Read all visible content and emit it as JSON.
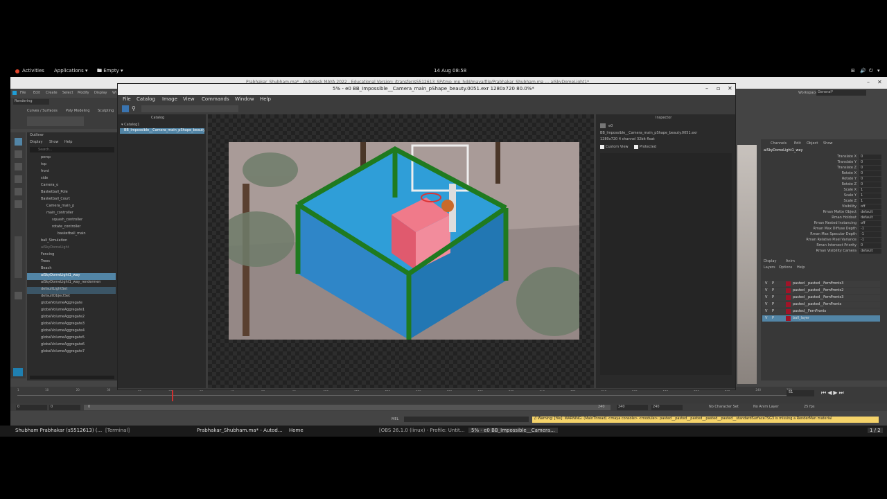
{
  "gnome_bar": {
    "activities": "Activities",
    "applications": "Applications",
    "workspace": "Empty",
    "clock": "14 Aug 08:58"
  },
  "maya": {
    "title": "Prabhakar_Shubham.ma* - Autodesk MAYA 2022 - Educational Version: /transfer/s5512613_SP/tmp_mp_hdd/maya/file/Prabhakar_Shubham.ma --- aiSkyDomeLight1*",
    "menu": [
      "File",
      "Edit",
      "Create",
      "Select",
      "Modify",
      "Display",
      "Wi"
    ],
    "mode": "Rendering",
    "shelf_tabs": [
      "Curves / Surfaces",
      "Poly Modeling",
      "Sculpting"
    ],
    "workspace_label": "Workspace:",
    "workspace_value": "General*",
    "outliner": {
      "title": "Outliner",
      "menu": [
        "Display",
        "Show",
        "Help"
      ],
      "search_placeholder": "Search...",
      "items": [
        "persp",
        "top",
        "front",
        "side",
        "Camera_o",
        "Basketball_Pole",
        "Basketball_Court",
        "Camera_main_p",
        "main_controller",
        "squash_controller",
        "rotate_controller",
        "basketball_main",
        "ball_Simulation",
        "aiSkyDomeLight",
        "Fencing",
        "Trees",
        "Beach",
        "aiSkyDomeLight1_way",
        "aiSkyDomeLight1_way_rendermen",
        "defaultLightSet",
        "defaultObjectSet",
        "globalVolumeAggregate",
        "globalVolumeAggregate1",
        "globalVolumeAggregate2",
        "globalVolumeAggregate3",
        "globalVolumeAggregate4",
        "globalVolumeAggregate5",
        "globalVolumeAggregate6",
        "globalVolumeAggregate7"
      ]
    },
    "channel_box": {
      "menu": [
        "Channels",
        "Edit",
        "Object",
        "Show"
      ],
      "object": "aiSkyDomeLight1_way",
      "attrs": [
        {
          "name": "Translate X",
          "value": "0"
        },
        {
          "name": "Translate Y",
          "value": "0"
        },
        {
          "name": "Translate Z",
          "value": "0"
        },
        {
          "name": "Rotate X",
          "value": "0"
        },
        {
          "name": "Rotate Y",
          "value": "0"
        },
        {
          "name": "Rotate Z",
          "value": "0"
        },
        {
          "name": "Scale X",
          "value": "1"
        },
        {
          "name": "Scale Y",
          "value": "1"
        },
        {
          "name": "Scale Z",
          "value": "1"
        },
        {
          "name": "Visibility",
          "value": "off"
        },
        {
          "name": "Rman Matte Object",
          "value": "default"
        },
        {
          "name": "Rman Holdout",
          "value": "default"
        },
        {
          "name": "Rman Nested Instancing",
          "value": "off"
        },
        {
          "name": "Rman Max Diffuse Depth",
          "value": "-1"
        },
        {
          "name": "Rman Max Specular Depth",
          "value": "-1"
        },
        {
          "name": "Rman Relative Pixel Variance",
          "value": "-1"
        },
        {
          "name": "Rman Intersect Priority",
          "value": "0"
        },
        {
          "name": "Rman Visibility Camera",
          "value": "default"
        }
      ]
    },
    "layer_editor": {
      "tabs": [
        "Display",
        "Anim"
      ],
      "menu": [
        "Layers",
        "Options",
        "Help"
      ],
      "layers": [
        {
          "v": "V",
          "p": "P",
          "name": "pasted__pasted__FernFronts3"
        },
        {
          "v": "V",
          "p": "P",
          "name": "pasted__pasted__FernFronts2"
        },
        {
          "v": "V",
          "p": "P",
          "name": "pasted__pasted__FernFronts3"
        },
        {
          "v": "V",
          "p": "P",
          "name": "pasted__pasted__FernFronts"
        },
        {
          "v": "V",
          "p": "P",
          "name": "pasted__FernFronts"
        },
        {
          "v": "V",
          "p": "P",
          "name": "ball_layer"
        }
      ]
    },
    "timeline": {
      "ticks": [
        "1",
        "10",
        "20",
        "30",
        "40",
        "50",
        "60",
        "70",
        "80",
        "90",
        "100",
        "110",
        "120",
        "130",
        "140",
        "150",
        "160",
        "170",
        "180",
        "190",
        "200",
        "210",
        "220",
        "230",
        "240",
        "250"
      ],
      "current_frame": "51",
      "current_marker": 51,
      "frame_max": 250,
      "range_start": "0",
      "range_start2": "0",
      "range_field": "0",
      "range_end": "240",
      "end_a": "240",
      "end_b": "240",
      "character_set": "No Character Set",
      "anim_layer": "No Anim Layer",
      "fps": "25 fps"
    },
    "command_line": {
      "label": "MEL",
      "warning": "// Warning: [file]: WARNING: (MainThread) <maya console> <module>: pasted__pasted__pasted__pasted__pasted__standardSurface7SG3 is missing a RenderMan material"
    }
  },
  "render_view": {
    "title": "5% - e0 BB_Impossible__Camera_main_pShape_beauty.0051.exr 1280x720 80.0%*",
    "menu": [
      "File",
      "Catalog",
      "Image",
      "View",
      "Commands",
      "Window",
      "Help"
    ],
    "catalog": {
      "title": "Catalog",
      "root": "Catalog1",
      "item": "BB_Impossible__Camera_main_pShape_beauty.0051.exr"
    },
    "inspector": {
      "title": "Inspector",
      "id": "e0",
      "filename": "BB_Impossible__Camera_main_pShape_beauty.0051.exr",
      "info": "1280x720 4 channel 32bit float",
      "custom_view": "Custom View",
      "protected": "Protected"
    }
  },
  "taskbar": {
    "items": [
      "Shubham Prabhakar (s5512613) (...",
      "[Terminal]",
      "Prabhakar_Shubham.ma* - Autod...",
      "Home",
      "[OBS 26.1.0 (linux) - Profile: Untit...",
      "5% - e0 BB_Impossible__Camera..."
    ],
    "pager": "1 / 2"
  }
}
